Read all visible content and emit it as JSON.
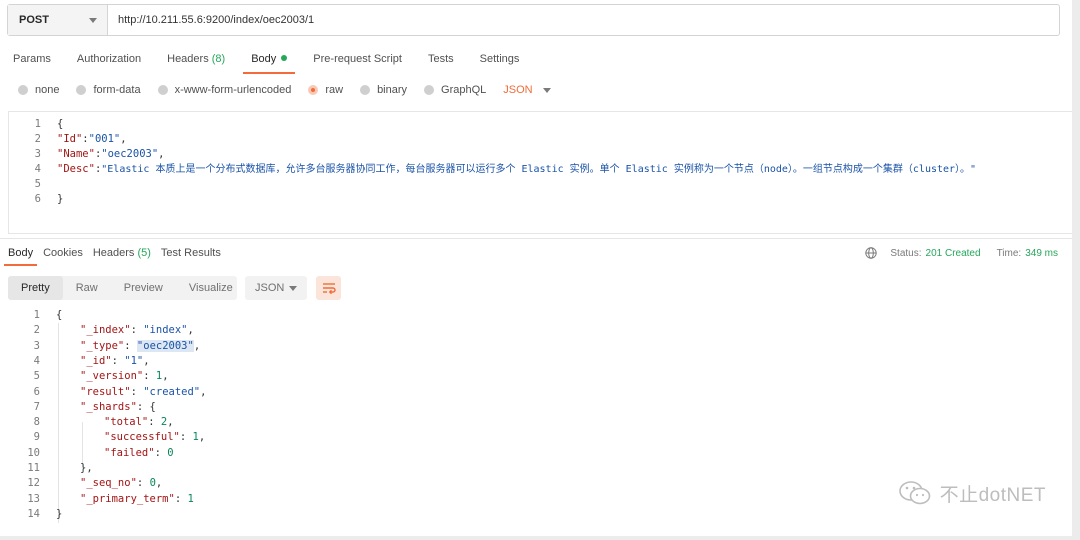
{
  "request": {
    "method": "POST",
    "url": "http://10.211.55.6:9200/index/oec2003/1"
  },
  "request_tabs": [
    {
      "label": "Params",
      "count": ""
    },
    {
      "label": "Authorization",
      "count": ""
    },
    {
      "label": "Headers",
      "count": "(8)"
    },
    {
      "label": "Body",
      "count": ""
    },
    {
      "label": "Pre-request Script",
      "count": ""
    },
    {
      "label": "Tests",
      "count": ""
    },
    {
      "label": "Settings",
      "count": ""
    }
  ],
  "body_types": [
    "none",
    "form-data",
    "x-www-form-urlencoded",
    "raw",
    "binary",
    "GraphQL"
  ],
  "body_format": "JSON",
  "request_body": {
    "line_numbers": [
      "1",
      "2",
      "3",
      "4",
      "5",
      "6"
    ],
    "open": "{",
    "id_key": "\"Id\"",
    "id_val": "\"001\"",
    "name_key": "\"Name\"",
    "name_val": "\"oec2003\"",
    "desc_key": "\"Desc\"",
    "desc_val": "\"Elastic 本质上是一个分布式数据库，允许多台服务器协同工作，每台服务器可以运行多个 Elastic 实例。单个 Elastic 实例称为一个节点（node）。一组节点构成一个集群（cluster）。\"",
    "close": "}"
  },
  "response_tabs": [
    {
      "label": "Body",
      "count": ""
    },
    {
      "label": "Cookies",
      "count": ""
    },
    {
      "label": "Headers",
      "count": "(5)"
    },
    {
      "label": "Test Results",
      "count": ""
    }
  ],
  "status": {
    "status_label": "Status:",
    "status_value": "201 Created",
    "time_label": "Time:",
    "time_value": "349 ms"
  },
  "view_modes": [
    "Pretty",
    "Raw",
    "Preview",
    "Visualize"
  ],
  "response_format": "JSON",
  "response_body": {
    "line_numbers": [
      "1",
      "2",
      "3",
      "4",
      "5",
      "6",
      "7",
      "8",
      "9",
      "10",
      "11",
      "12",
      "13",
      "14"
    ],
    "open": "{",
    "index_key": "\"_index\"",
    "index_val": "\"index\"",
    "type_key": "\"_type\"",
    "type_val": "\"oec2003\"",
    "id_key": "\"_id\"",
    "id_val": "\"1\"",
    "version_key": "\"_version\"",
    "version_val": "1",
    "result_key": "\"result\"",
    "result_val": "\"created\"",
    "shards_key": "\"_shards\"",
    "total_key": "\"total\"",
    "total_val": "2",
    "successful_key": "\"successful\"",
    "successful_val": "1",
    "failed_key": "\"failed\"",
    "failed_val": "0",
    "shards_close": "},",
    "seq_key": "\"_seq_no\"",
    "seq_val": "0",
    "primary_key": "\"_primary_term\"",
    "primary_val": "1",
    "close": "}"
  },
  "watermark": "不止dotNET",
  "colors": {
    "accent": "#f26b3a",
    "success": "#26a75a",
    "json_key": "#a31515",
    "json_string": "#1a53a8",
    "json_number": "#098658"
  }
}
